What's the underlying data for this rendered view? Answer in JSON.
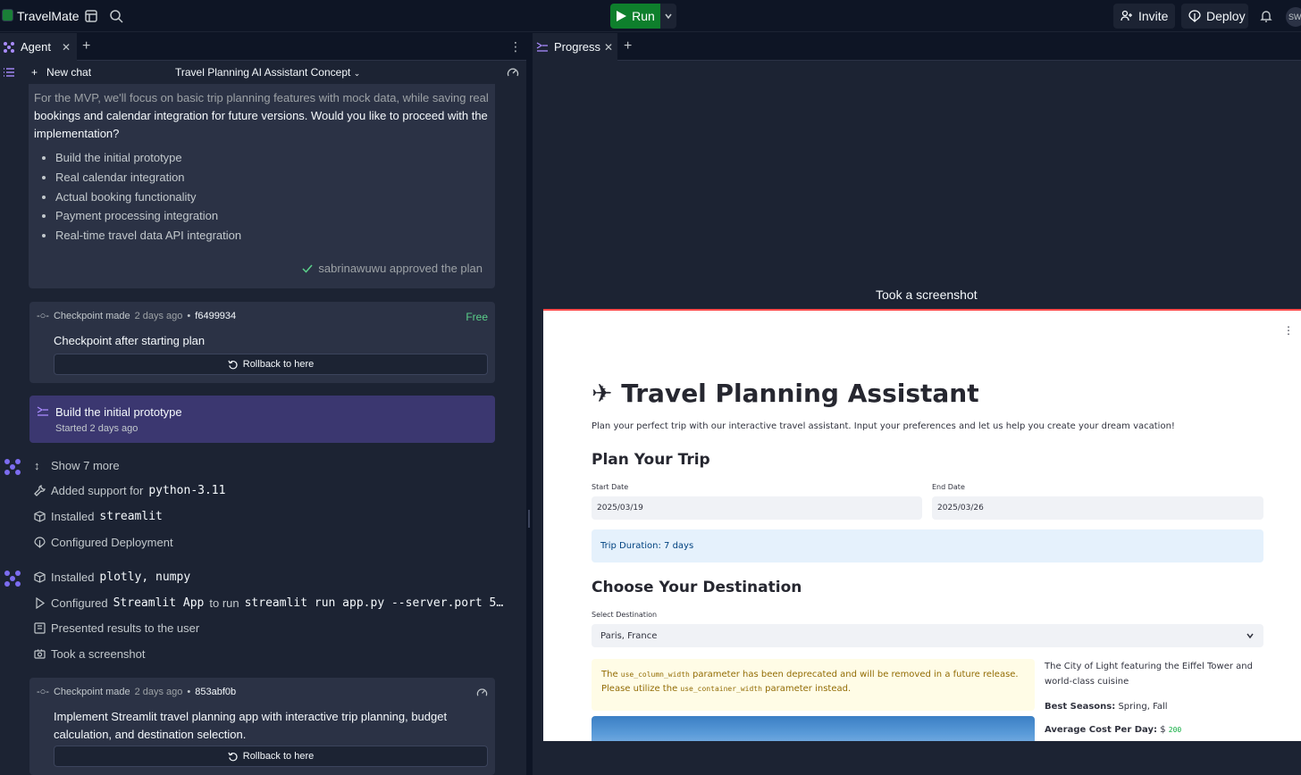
{
  "topbar": {
    "app_name": "TravelMate",
    "run_label": "Run",
    "invite_label": "Invite",
    "deploy_label": "Deploy",
    "avatar_initials": "SW"
  },
  "left": {
    "tab_label": "Agent",
    "new_chat_label": "New chat",
    "chat_title": "Travel Planning AI Assistant Concept",
    "plan": {
      "faded_text": "For the MVP, we'll focus on basic trip planning features with mock data, while saving real",
      "text": "bookings and calendar integration for future versions. Would you like to proceed with the implementation?",
      "items": [
        "Build the initial prototype",
        "Real calendar integration",
        "Actual booking functionality",
        "Payment processing integration",
        "Real-time travel data API integration"
      ],
      "approved_text": "sabrinawuwu approved the plan"
    },
    "checkpoint1": {
      "label": "Checkpoint made",
      "time": "2 days ago",
      "hash": "f6499934",
      "badge": "Free",
      "title": "Checkpoint after starting plan",
      "rollback": "Rollback to here"
    },
    "build": {
      "title": "Build the initial prototype",
      "started": "Started",
      "time": "2 days ago"
    },
    "actions": {
      "show_more": "Show 7 more",
      "added_support_prefix": "Added support for",
      "added_support_code": "python-3.11",
      "installed_prefix": "Installed",
      "installed_code": "streamlit",
      "configured_deployment": "Configured Deployment",
      "installed2_code": "plotly, numpy",
      "configured_prefix": "Configured",
      "configured_code": "Streamlit App",
      "configured_mid": "to run",
      "configured_cmd": "streamlit run app.py --server.port 5…",
      "presented": "Presented results to the user",
      "took_screenshot": "Took a screenshot"
    },
    "checkpoint2": {
      "label": "Checkpoint made",
      "time": "2 days ago",
      "hash": "853abf0b",
      "title": "Implement Streamlit travel planning app with interactive trip planning, budget calculation, and destination selection.",
      "rollback": "Rollback to here"
    }
  },
  "right": {
    "tab_label": "Progress",
    "shot_label": "Took a screenshot",
    "app": {
      "title": "✈ Travel Planning Assistant",
      "description": "Plan your perfect trip with our interactive travel assistant. Input your preferences and let us help you create your dream vacation!",
      "plan_heading": "Plan Your Trip",
      "start_label": "Start Date",
      "start_value": "2025/03/19",
      "end_label": "End Date",
      "end_value": "2025/03/26",
      "duration": "Trip Duration: 7 days",
      "dest_heading": "Choose Your Destination",
      "select_label": "Select Destination",
      "select_value": "Paris, France",
      "warn_the": "The",
      "warn_code1": "use_column_width",
      "warn_mid": "parameter has been deprecated and will be removed in a future release. Please utilize the",
      "warn_code2": "use_container_width",
      "warn_end": "parameter instead.",
      "dest_desc": "The City of Light featuring the Eiffel Tower and world-class cuisine",
      "best_label": "Best Seasons:",
      "best_value": "Spring, Fall",
      "cost_label": "Average Cost Per Day:",
      "cost_currency": "$",
      "cost_value": "200"
    }
  }
}
